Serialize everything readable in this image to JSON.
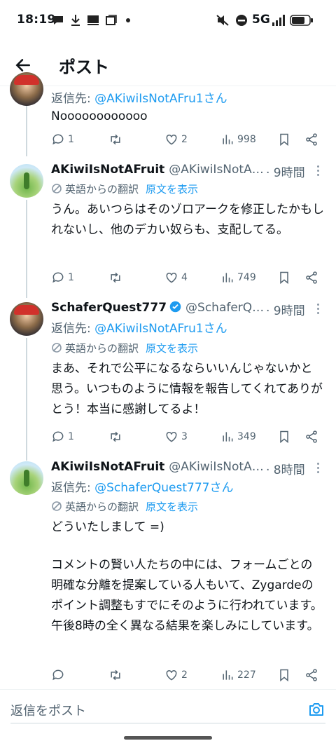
{
  "status_bar": {
    "time": "18:19",
    "network": "5G"
  },
  "header": {
    "title": "ポスト"
  },
  "posts": [
    {
      "reply_to_prefix": "返信先: ",
      "reply_to_mention": "@AKiwiIsNotAFru1さん",
      "text": "Noooooooooooo",
      "stats": {
        "replies": "1",
        "reposts": "",
        "likes": "2",
        "views": "998"
      }
    },
    {
      "name": "AKiwiIsNotAFruit",
      "handle": "@AKiwiIsNotA…",
      "time": "· 9時間",
      "translated_label": "英語からの翻訳",
      "show_original": "原文を表示",
      "text": "うん。あいつらはそのゾロアークを修正したかもしれないし、他のデカい奴らも、支配してる。",
      "stats": {
        "replies": "1",
        "reposts": "",
        "likes": "4",
        "views": "749"
      }
    },
    {
      "name": "SchaferQuest777",
      "handle": "@SchaferQ…",
      "time": "· 9時間",
      "reply_to_prefix": "返信先: ",
      "reply_to_mention": "@AKiwiIsNotAFru1さん",
      "translated_label": "英語からの翻訳",
      "show_original": "原文を表示",
      "text": "まあ、それで公平になるならいいんじゃないかと思う。いつものように情報を報告してくれてありがとう！本当に感謝してるよ！",
      "stats": {
        "replies": "1",
        "reposts": "",
        "likes": "3",
        "views": "349"
      }
    },
    {
      "name": "AKiwiIsNotAFruit",
      "handle": "@AKiwiIsNotA…",
      "time": "· 8時間",
      "reply_to_prefix": "返信先: ",
      "reply_to_mention": "@SchaferQuest777さん",
      "translated_label": "英語からの翻訳",
      "show_original": "原文を表示",
      "text_line1": "どういたしまして =)",
      "text_para2": "コメントの賢い人たちの中には、フォームごとの明確な分離を提案している人もいて、Zygardeのポイント調整もすでにそのように行われています。午後8時の全く異なる結果を楽しみにしています。",
      "stats": {
        "replies": "",
        "reposts": "",
        "likes": "2",
        "views": "227"
      }
    }
  ],
  "reply_bar": {
    "placeholder": "返信をポスト"
  },
  "colors": {
    "accent": "#1d9bf0",
    "secondary_text": "#536471",
    "thread_line": "#cfd9de"
  }
}
